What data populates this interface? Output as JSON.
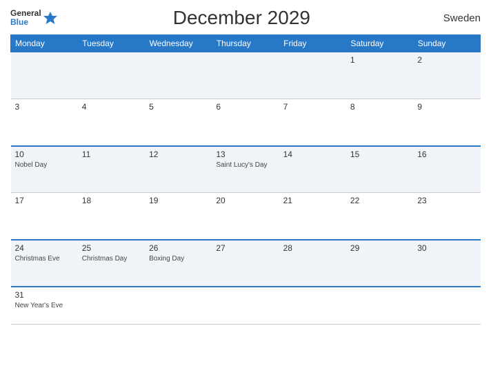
{
  "header": {
    "brand_general": "General",
    "brand_blue": "Blue",
    "title": "December 2029",
    "country": "Sweden"
  },
  "weekdays": [
    "Monday",
    "Tuesday",
    "Wednesday",
    "Thursday",
    "Friday",
    "Saturday",
    "Sunday"
  ],
  "rows": [
    [
      {
        "day": "",
        "event": ""
      },
      {
        "day": "",
        "event": ""
      },
      {
        "day": "",
        "event": ""
      },
      {
        "day": "",
        "event": ""
      },
      {
        "day": "",
        "event": ""
      },
      {
        "day": "1",
        "event": ""
      },
      {
        "day": "2",
        "event": ""
      }
    ],
    [
      {
        "day": "3",
        "event": ""
      },
      {
        "day": "4",
        "event": ""
      },
      {
        "day": "5",
        "event": ""
      },
      {
        "day": "6",
        "event": ""
      },
      {
        "day": "7",
        "event": ""
      },
      {
        "day": "8",
        "event": ""
      },
      {
        "day": "9",
        "event": ""
      }
    ],
    [
      {
        "day": "10",
        "event": "Nobel Day"
      },
      {
        "day": "11",
        "event": ""
      },
      {
        "day": "12",
        "event": ""
      },
      {
        "day": "13",
        "event": "Saint Lucy's Day"
      },
      {
        "day": "14",
        "event": ""
      },
      {
        "day": "15",
        "event": ""
      },
      {
        "day": "16",
        "event": ""
      }
    ],
    [
      {
        "day": "17",
        "event": ""
      },
      {
        "day": "18",
        "event": ""
      },
      {
        "day": "19",
        "event": ""
      },
      {
        "day": "20",
        "event": ""
      },
      {
        "day": "21",
        "event": ""
      },
      {
        "day": "22",
        "event": ""
      },
      {
        "day": "23",
        "event": ""
      }
    ],
    [
      {
        "day": "24",
        "event": "Christmas Eve"
      },
      {
        "day": "25",
        "event": "Christmas Day"
      },
      {
        "day": "26",
        "event": "Boxing Day"
      },
      {
        "day": "27",
        "event": ""
      },
      {
        "day": "28",
        "event": ""
      },
      {
        "day": "29",
        "event": ""
      },
      {
        "day": "30",
        "event": ""
      }
    ],
    [
      {
        "day": "31",
        "event": "New Year's Eve"
      },
      {
        "day": "",
        "event": ""
      },
      {
        "day": "",
        "event": ""
      },
      {
        "day": "",
        "event": ""
      },
      {
        "day": "",
        "event": ""
      },
      {
        "day": "",
        "event": ""
      },
      {
        "day": "",
        "event": ""
      }
    ]
  ]
}
